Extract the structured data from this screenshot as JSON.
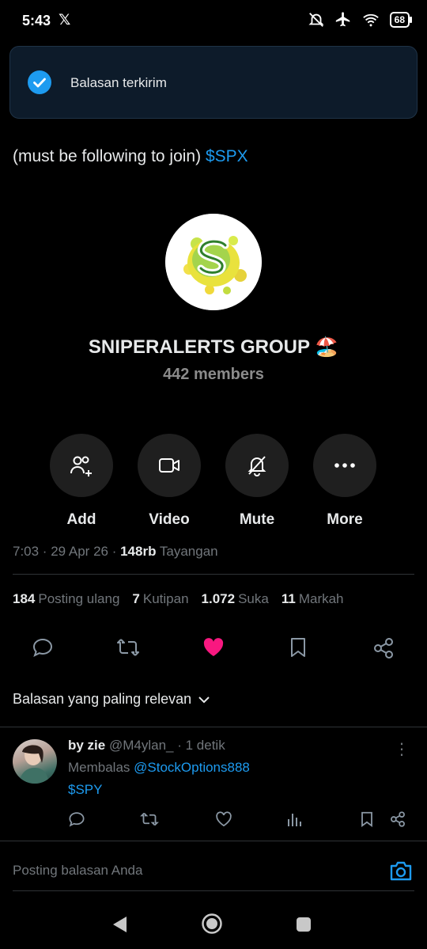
{
  "status_bar": {
    "time": "5:43",
    "x_logo": "𝕏",
    "battery": "68"
  },
  "toast": {
    "text": "Balasan terkirim",
    "icon": "check-circle-icon"
  },
  "tweet": {
    "text_prefix": "(must be following to join) ",
    "cashtag": "$SPX",
    "group": {
      "name": "SNIPERALERTS GROUP 🏖️",
      "members": "442 members"
    },
    "actions": [
      {
        "label": "Add",
        "icon": "add-people-icon"
      },
      {
        "label": "Video",
        "icon": "video-icon"
      },
      {
        "label": "Mute",
        "icon": "bell-off-icon"
      },
      {
        "label": "More",
        "icon": "more-icon"
      }
    ],
    "meta": {
      "time": "7:03 · 29 Apr 26 · ",
      "views_count": "148rb",
      "views_label": " Tayangan"
    },
    "stats": {
      "reposts_count": "184",
      "reposts_label": "Posting ulang",
      "quotes_count": "7",
      "quotes_label": "Kutipan",
      "likes_count": "1.072",
      "likes_label": "Suka",
      "bookmarks_count": "11",
      "bookmarks_label": "Markah"
    }
  },
  "replies_sort": {
    "label": "Balasan yang paling relevan"
  },
  "reply": {
    "name": "by zie",
    "handle": "@M4ylan_ · 1 detik",
    "replying_prefix": "Membalas ",
    "replying_to": "@StockOptions888",
    "text": "$SPY"
  },
  "compose": {
    "placeholder": "Posting balasan Anda"
  },
  "colors": {
    "accent": "#1d9bf0",
    "like": "#f91880",
    "background": "#000000",
    "toast_bg": "#0d1b2a"
  }
}
